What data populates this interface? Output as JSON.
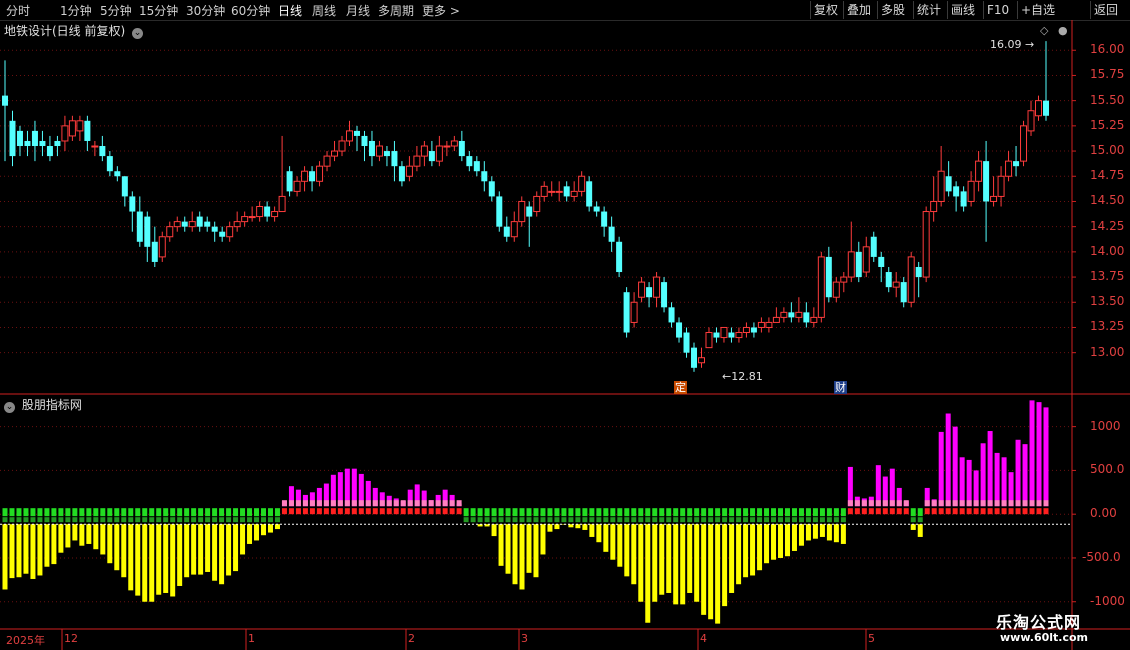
{
  "toolbar": {
    "period_tabs": [
      "分时",
      "1分钟",
      "5分钟",
      "15分钟",
      "30分钟",
      "60分钟",
      "日线",
      "周线",
      "月线",
      "多周期",
      "更多 >"
    ],
    "active_tab": "日线",
    "right_buttons": [
      "复权",
      "叠加",
      "多股",
      "统计",
      "画线",
      "F10",
      "+自选",
      "返回"
    ]
  },
  "main_panel": {
    "title": "地铁设计(日线 前复权)",
    "price_axis_labels": [
      "16.00",
      "15.75",
      "15.50",
      "15.25",
      "15.00",
      "14.75",
      "14.50",
      "14.25",
      "14.00",
      "13.75",
      "13.50",
      "13.25",
      "13.00"
    ],
    "high_annotation": "16.09",
    "low_annotation": "12.81",
    "event_markers": [
      "定",
      "财"
    ]
  },
  "indicator_panel": {
    "title": "股朋指标网",
    "axis_labels": [
      "1000",
      "500.0",
      "0.00",
      "-500.0",
      "-1000"
    ]
  },
  "date_axis": {
    "labels": [
      "2025年",
      "12",
      "1",
      "2",
      "3",
      "4",
      "5"
    ]
  },
  "watermark": {
    "line1": "乐淘公式网",
    "line2": "www.60lt.com"
  },
  "colors": {
    "up": "#ff3c3c",
    "down": "#54ffff",
    "positive_bar": "#ff00ff",
    "negative_bar": "#ffff00",
    "axis_red": "#d02020",
    "grid": "#6a1010"
  },
  "chart_data": [
    {
      "type": "candlestick",
      "title": "地铁设计(日线 前复权)",
      "ylim": [
        12.6,
        16.3
      ],
      "candles": [
        [
          15.55,
          15.45,
          15.9,
          14.9
        ],
        [
          15.3,
          14.95,
          15.4,
          14.85
        ],
        [
          15.2,
          15.05,
          15.25,
          14.95
        ],
        [
          15.1,
          15.05,
          15.2,
          14.95
        ],
        [
          15.2,
          15.05,
          15.3,
          14.9
        ],
        [
          15.1,
          15.05,
          15.2,
          14.95
        ],
        [
          15.05,
          14.95,
          15.15,
          14.9
        ],
        [
          15.1,
          15.05,
          15.15,
          14.95
        ],
        [
          15.1,
          15.25,
          15.35,
          15.0
        ],
        [
          15.15,
          15.3,
          15.35,
          15.1
        ],
        [
          15.2,
          15.3,
          15.35,
          15.1
        ],
        [
          15.3,
          15.1,
          15.35,
          15.0
        ],
        [
          15.05,
          15.05,
          15.1,
          14.95
        ],
        [
          15.05,
          14.95,
          15.15,
          14.9
        ],
        [
          14.95,
          14.8,
          15.0,
          14.75
        ],
        [
          14.8,
          14.75,
          14.85,
          14.7
        ],
        [
          14.75,
          14.55,
          14.75,
          14.45
        ],
        [
          14.55,
          14.4,
          14.6,
          14.2
        ],
        [
          14.4,
          14.1,
          14.55,
          14.05
        ],
        [
          14.35,
          14.05,
          14.4,
          13.9
        ],
        [
          14.1,
          13.9,
          14.25,
          13.85
        ],
        [
          13.95,
          14.15,
          14.2,
          13.9
        ],
        [
          14.15,
          14.25,
          14.3,
          14.1
        ],
        [
          14.25,
          14.3,
          14.35,
          14.2
        ],
        [
          14.3,
          14.25,
          14.35,
          14.2
        ],
        [
          14.25,
          14.3,
          14.4,
          14.2
        ],
        [
          14.35,
          14.25,
          14.4,
          14.2
        ],
        [
          14.3,
          14.25,
          14.35,
          14.2
        ],
        [
          14.25,
          14.2,
          14.3,
          14.1
        ],
        [
          14.2,
          14.15,
          14.25,
          14.1
        ],
        [
          14.15,
          14.25,
          14.3,
          14.1
        ],
        [
          14.25,
          14.3,
          14.4,
          14.2
        ],
        [
          14.3,
          14.35,
          14.4,
          14.25
        ],
        [
          14.35,
          14.35,
          14.45,
          14.3
        ],
        [
          14.35,
          14.45,
          14.5,
          14.3
        ],
        [
          14.45,
          14.35,
          14.5,
          14.3
        ],
        [
          14.35,
          14.4,
          14.45,
          14.3
        ],
        [
          14.4,
          14.55,
          15.15,
          14.4
        ],
        [
          14.8,
          14.6,
          14.85,
          14.55
        ],
        [
          14.6,
          14.7,
          14.75,
          14.55
        ],
        [
          14.7,
          14.8,
          14.85,
          14.6
        ],
        [
          14.8,
          14.7,
          14.85,
          14.6
        ],
        [
          14.7,
          14.85,
          14.9,
          14.65
        ],
        [
          14.85,
          14.95,
          15.0,
          14.8
        ],
        [
          14.95,
          15.0,
          15.1,
          14.9
        ],
        [
          15.0,
          15.1,
          15.15,
          14.95
        ],
        [
          15.1,
          15.2,
          15.3,
          15.05
        ],
        [
          15.2,
          15.15,
          15.25,
          15.0
        ],
        [
          15.15,
          15.05,
          15.2,
          14.9
        ],
        [
          15.1,
          14.95,
          15.2,
          14.85
        ],
        [
          14.95,
          15.05,
          15.1,
          14.9
        ],
        [
          15.0,
          14.95,
          15.05,
          14.85
        ],
        [
          15.0,
          14.85,
          15.1,
          14.7
        ],
        [
          14.85,
          14.7,
          14.9,
          14.65
        ],
        [
          14.75,
          14.85,
          14.95,
          14.7
        ],
        [
          14.85,
          14.95,
          15.05,
          14.8
        ],
        [
          14.95,
          15.05,
          15.1,
          14.85
        ],
        [
          15.0,
          14.9,
          15.1,
          14.85
        ],
        [
          14.9,
          15.05,
          15.15,
          14.85
        ],
        [
          15.05,
          15.05,
          15.1,
          14.95
        ],
        [
          15.05,
          15.1,
          15.15,
          15.0
        ],
        [
          15.1,
          14.95,
          15.2,
          14.9
        ],
        [
          14.95,
          14.85,
          15.0,
          14.8
        ],
        [
          14.9,
          14.8,
          14.95,
          14.75
        ],
        [
          14.8,
          14.7,
          14.9,
          14.6
        ],
        [
          14.7,
          14.55,
          14.75,
          14.5
        ],
        [
          14.55,
          14.25,
          14.6,
          14.2
        ],
        [
          14.25,
          14.15,
          14.35,
          14.1
        ],
        [
          14.15,
          14.3,
          14.4,
          14.1
        ],
        [
          14.3,
          14.5,
          14.55,
          14.25
        ],
        [
          14.45,
          14.35,
          14.5,
          14.05
        ],
        [
          14.4,
          14.55,
          14.6,
          14.35
        ],
        [
          14.55,
          14.65,
          14.7,
          14.5
        ],
        [
          14.6,
          14.6,
          14.7,
          14.55
        ],
        [
          14.6,
          14.6,
          14.7,
          14.5
        ],
        [
          14.65,
          14.55,
          14.7,
          14.5
        ],
        [
          14.55,
          14.6,
          14.7,
          14.5
        ],
        [
          14.6,
          14.75,
          14.8,
          14.55
        ],
        [
          14.7,
          14.45,
          14.75,
          14.4
        ],
        [
          14.45,
          14.4,
          14.5,
          14.35
        ],
        [
          14.4,
          14.25,
          14.45,
          14.15
        ],
        [
          14.25,
          14.1,
          14.35,
          14.0
        ],
        [
          14.1,
          13.8,
          14.15,
          13.75
        ],
        [
          13.6,
          13.2,
          13.65,
          13.15
        ],
        [
          13.3,
          13.5,
          13.6,
          13.25
        ],
        [
          13.55,
          13.7,
          13.75,
          13.5
        ],
        [
          13.65,
          13.55,
          13.7,
          13.45
        ],
        [
          13.55,
          13.75,
          13.8,
          13.45
        ],
        [
          13.7,
          13.45,
          13.75,
          13.4
        ],
        [
          13.45,
          13.3,
          13.5,
          13.25
        ],
        [
          13.3,
          13.15,
          13.35,
          13.1
        ],
        [
          13.2,
          13.0,
          13.25,
          12.95
        ],
        [
          13.05,
          12.85,
          13.1,
          12.81
        ],
        [
          12.9,
          12.95,
          13.05,
          12.85
        ],
        [
          13.05,
          13.2,
          13.25,
          13.05
        ],
        [
          13.2,
          13.15,
          13.25,
          13.1
        ],
        [
          13.15,
          13.25,
          13.25,
          13.1
        ],
        [
          13.2,
          13.15,
          13.25,
          13.1
        ],
        [
          13.15,
          13.2,
          13.25,
          13.1
        ],
        [
          13.2,
          13.25,
          13.3,
          13.15
        ],
        [
          13.25,
          13.2,
          13.3,
          13.15
        ],
        [
          13.25,
          13.3,
          13.35,
          13.2
        ],
        [
          13.25,
          13.3,
          13.35,
          13.2
        ],
        [
          13.3,
          13.35,
          13.45,
          13.3
        ],
        [
          13.35,
          13.4,
          13.45,
          13.3
        ],
        [
          13.4,
          13.35,
          13.5,
          13.3
        ],
        [
          13.35,
          13.4,
          13.55,
          13.3
        ],
        [
          13.4,
          13.3,
          13.5,
          13.25
        ],
        [
          13.3,
          13.35,
          13.45,
          13.25
        ],
        [
          13.35,
          13.95,
          14.0,
          13.3
        ],
        [
          13.95,
          13.55,
          14.05,
          13.5
        ],
        [
          13.55,
          13.7,
          13.75,
          13.5
        ],
        [
          13.7,
          13.75,
          13.8,
          13.6
        ],
        [
          13.75,
          14.0,
          14.3,
          13.7
        ],
        [
          14.0,
          13.75,
          14.1,
          13.7
        ],
        [
          13.8,
          14.05,
          14.15,
          13.75
        ],
        [
          14.15,
          13.95,
          14.2,
          13.9
        ],
        [
          13.95,
          13.85,
          14.0,
          13.7
        ],
        [
          13.8,
          13.65,
          13.85,
          13.6
        ],
        [
          13.65,
          13.7,
          13.8,
          13.55
        ],
        [
          13.7,
          13.5,
          13.75,
          13.45
        ],
        [
          13.5,
          13.95,
          14.0,
          13.45
        ],
        [
          13.85,
          13.75,
          13.9,
          13.55
        ],
        [
          13.75,
          14.4,
          14.45,
          13.7
        ],
        [
          14.4,
          14.5,
          14.75,
          14.3
        ],
        [
          14.5,
          14.8,
          15.05,
          14.45
        ],
        [
          14.75,
          14.6,
          14.9,
          14.55
        ],
        [
          14.65,
          14.55,
          14.7,
          14.4
        ],
        [
          14.6,
          14.45,
          14.65,
          14.4
        ],
        [
          14.5,
          14.7,
          14.8,
          14.45
        ],
        [
          14.7,
          14.9,
          15.0,
          14.6
        ],
        [
          14.9,
          14.5,
          15.1,
          14.1
        ],
        [
          14.5,
          14.55,
          14.75,
          14.45
        ],
        [
          14.55,
          14.75,
          14.85,
          14.45
        ],
        [
          14.75,
          14.9,
          15.0,
          14.7
        ],
        [
          14.9,
          14.85,
          15.05,
          14.75
        ],
        [
          14.9,
          15.25,
          15.3,
          14.85
        ],
        [
          15.2,
          15.4,
          15.5,
          15.15
        ],
        [
          15.35,
          15.5,
          15.55,
          15.3
        ],
        [
          15.5,
          15.35,
          16.09,
          15.3
        ]
      ]
    },
    {
      "type": "bar",
      "title": "股朋指标网",
      "ylim": [
        -1300,
        1350
      ],
      "values": [
        -860,
        -730,
        -720,
        -680,
        -740,
        -700,
        -600,
        -570,
        -440,
        -380,
        -300,
        -360,
        -340,
        -400,
        -460,
        -560,
        -640,
        -720,
        -870,
        -930,
        -1000,
        -1000,
        -920,
        -900,
        -940,
        -820,
        -720,
        -690,
        -690,
        -660,
        -760,
        -800,
        -700,
        -650,
        -460,
        -340,
        -300,
        -240,
        -210,
        -170,
        150,
        320,
        280,
        220,
        250,
        300,
        350,
        450,
        480,
        520,
        520,
        460,
        380,
        300,
        250,
        210,
        180,
        150,
        280,
        340,
        270,
        160,
        220,
        280,
        220,
        120,
        -100,
        -80,
        -140,
        -140,
        -250,
        -590,
        -680,
        -800,
        -860,
        -670,
        -720,
        -460,
        -200,
        -170,
        -120,
        -150,
        -160,
        -180,
        -260,
        -320,
        -430,
        -520,
        -600,
        -710,
        -800,
        -1000,
        -1240,
        -1000,
        -920,
        -900,
        -1030,
        -1030,
        -900,
        -1000,
        -1150,
        -1200,
        -1250,
        -1050,
        -900,
        -800,
        -720,
        -700,
        -640,
        -560,
        -520,
        -500,
        -480,
        -420,
        -360,
        -300,
        -280,
        -260,
        -300,
        -320,
        -340,
        540,
        200,
        180,
        200,
        560,
        430,
        520,
        300,
        150,
        -180,
        -260,
        300,
        170,
        940,
        1150,
        1000,
        650,
        620,
        500,
        810,
        950,
        700,
        650,
        480,
        850,
        800,
        1300,
        1280,
        1220
      ]
    }
  ]
}
